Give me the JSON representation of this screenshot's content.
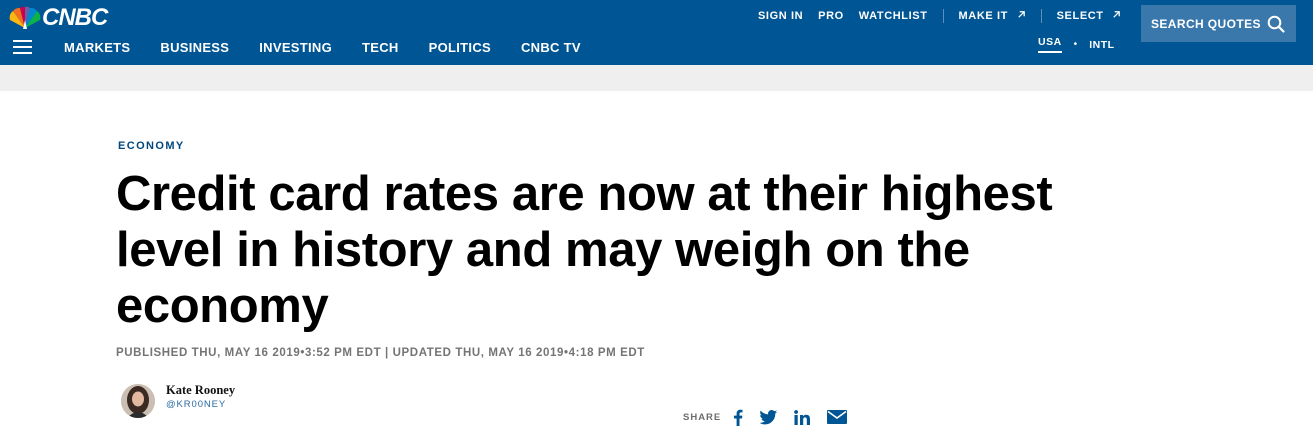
{
  "brand": {
    "logo_text": "CNBC",
    "primary_color": "#005594",
    "accent_blue": "#00477f"
  },
  "main_nav": [
    {
      "label": "MARKETS"
    },
    {
      "label": "BUSINESS"
    },
    {
      "label": "INVESTING"
    },
    {
      "label": "TECH"
    },
    {
      "label": "POLITICS"
    },
    {
      "label": "CNBC TV"
    }
  ],
  "util_nav": {
    "sign_in": "SIGN IN",
    "pro": "PRO",
    "watchlist": "WATCHLIST",
    "make_it": "MAKE IT",
    "select": "SELECT"
  },
  "region": {
    "usa": "USA",
    "separator": "•",
    "intl": "INTL"
  },
  "search": {
    "label": "SEARCH QUOTES",
    "icon": "search-icon"
  },
  "article": {
    "section": "ECONOMY",
    "headline": "Credit card rates are now at their highest level in history and may weigh on the economy",
    "timestamp": "PUBLISHED THU, MAY 16 2019•3:52 PM EDT | UPDATED THU, MAY 16 2019•4:18 PM EDT",
    "author": {
      "name": "Kate Rooney",
      "handle": "@KR00NEY"
    }
  },
  "share": {
    "label": "SHARE",
    "icons": [
      "facebook-icon",
      "twitter-icon",
      "linkedin-icon",
      "email-icon"
    ]
  }
}
